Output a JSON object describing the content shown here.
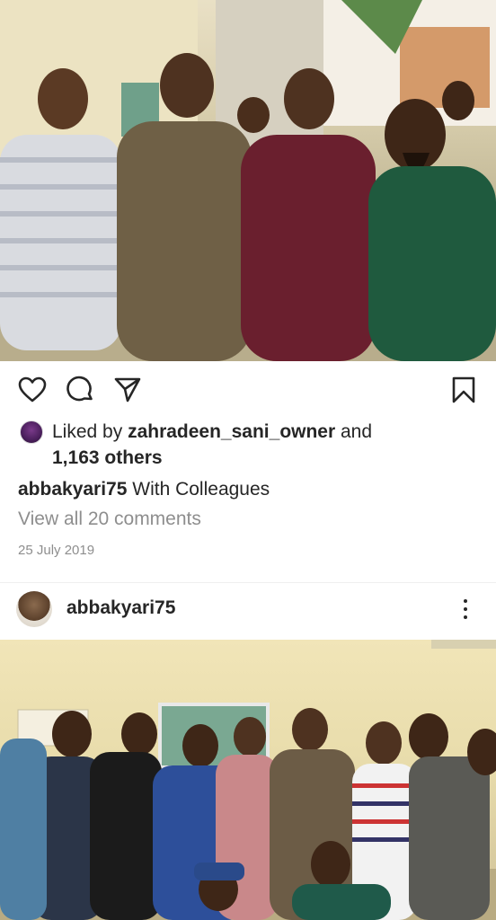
{
  "post1": {
    "photo_alt": "group photo",
    "liker_avatar_icon": "avatar-icon",
    "likes": {
      "prefix": "Liked by ",
      "liker": "zahradeen_sani_owner",
      "connector": " and",
      "others": "1,163 others"
    },
    "caption": {
      "username": "abbakyari75",
      "text": " With Colleagues"
    },
    "comments_link": "View all 20 comments",
    "date": "25 July 2019"
  },
  "post2": {
    "username": "abbakyari75",
    "more_icon": "more-vertical-icon"
  },
  "icons": {
    "like": "heart-icon",
    "comment": "comment-icon",
    "share": "send-icon",
    "save": "bookmark-icon"
  },
  "colors": {
    "text": "#262626",
    "muted": "#8e8e8e",
    "background": "#ffffff"
  }
}
